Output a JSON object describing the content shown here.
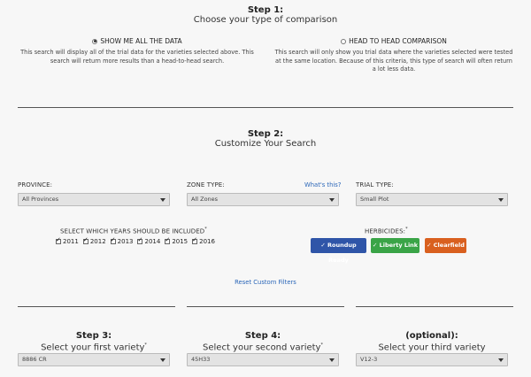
{
  "step1": {
    "title": "Step 1:",
    "subtitle": "Choose your type of comparison",
    "options": [
      {
        "label": "SHOW ME ALL THE DATA",
        "selected": true,
        "desc1": "This search will display all of the trial data for the varieties selected above. This",
        "desc2": "search will return more results than a head-to-head search.",
        "desc3": ""
      },
      {
        "label": "HEAD TO HEAD COMPARISON",
        "selected": false,
        "desc1": "This search will only show you trial data where the varieties selected were tested",
        "desc2": "at the same location. Because of this criteria, this type of search will often return",
        "desc3": "a lot less data."
      }
    ]
  },
  "step2": {
    "title": "Step 2:",
    "subtitle": "Customize Your Search",
    "province_label": "PROVINCE:",
    "province_value": "All Provinces",
    "zone_label": "ZONE TYPE:",
    "zone_link": "What's this?",
    "zone_value": "All Zones",
    "trial_label": "TRIAL TYPE:",
    "trial_value": "Small Plot",
    "years_label": "SELECT WHICH YEARS SHOULD BE INCLUDED",
    "required_mark": "*",
    "years": [
      "2011",
      "2012",
      "2013",
      "2014",
      "2015",
      "2016"
    ],
    "herbicides_label": "HERBICIDES:",
    "herbicides": [
      {
        "label": "✓ Roundup Ready",
        "color": "#2f55a8"
      },
      {
        "label": "✓ Liberty Link",
        "color": "#3aa447"
      },
      {
        "label": "✓ Clearfield",
        "color": "#d9601f"
      }
    ],
    "reset_link": "Reset Custom Filters"
  },
  "varieties": [
    {
      "title": "Step 3:",
      "subtitle": "Select your first variety",
      "required": "*",
      "value": "8886 CR"
    },
    {
      "title": "Step 4:",
      "subtitle": "Select your second variety",
      "required": "*",
      "value": "45H33"
    },
    {
      "title": "(optional):",
      "subtitle": "Select your third variety",
      "required": "",
      "value": "V12-3"
    }
  ]
}
